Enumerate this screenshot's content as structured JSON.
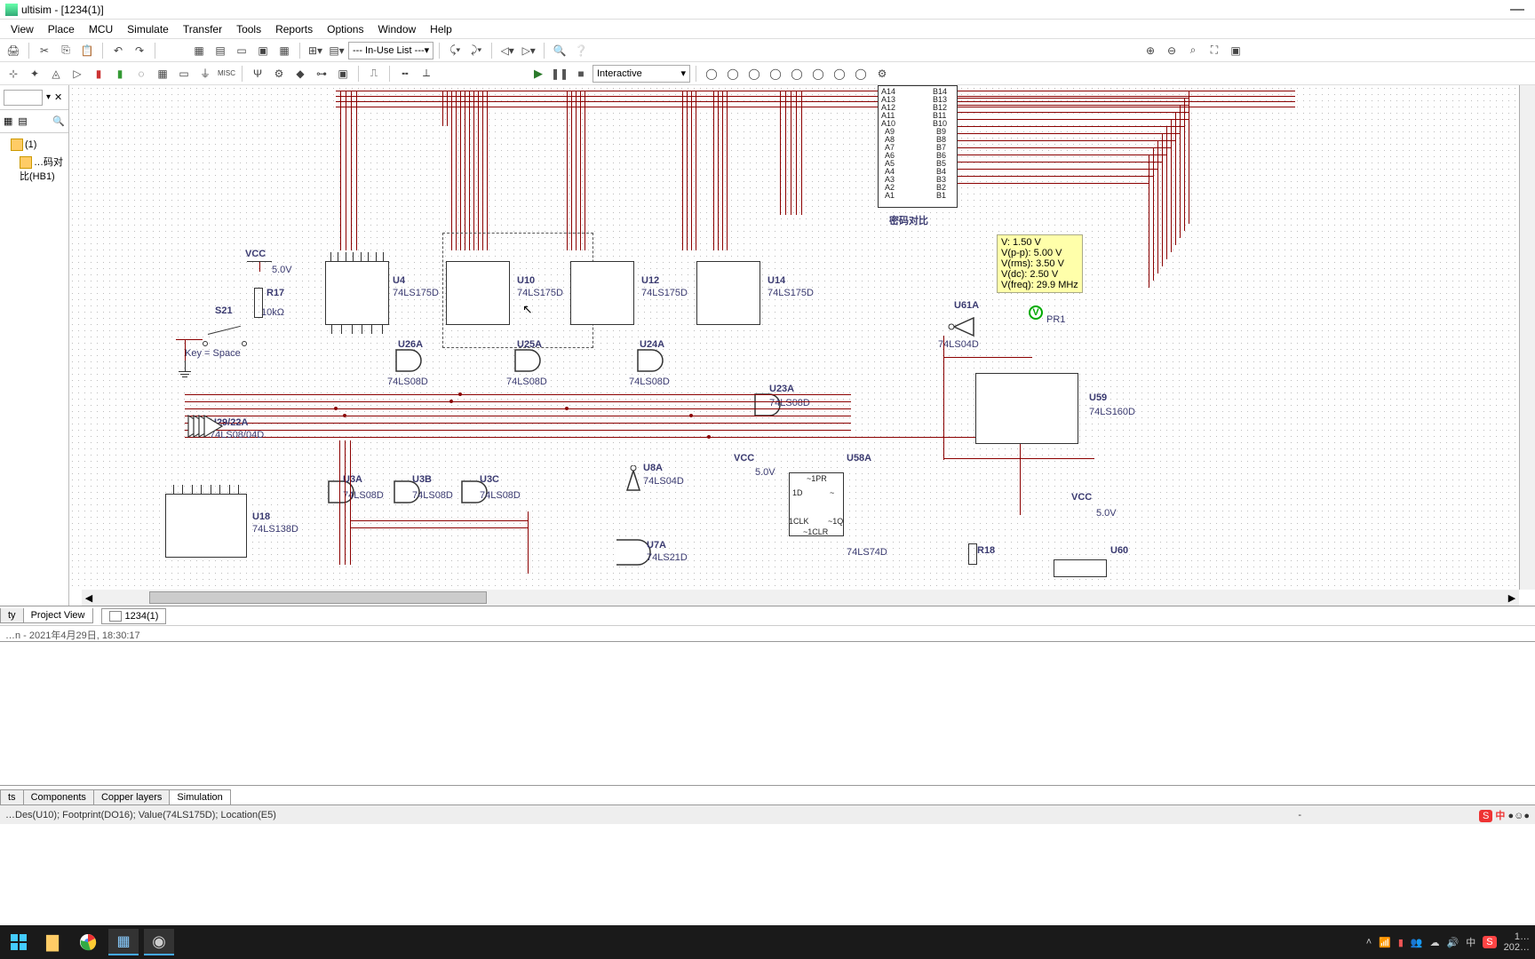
{
  "app": {
    "title": "ultisim - [1234(1)]"
  },
  "menu": {
    "items": [
      "View",
      "Place",
      "MCU",
      "Simulate",
      "Transfer",
      "Tools",
      "Reports",
      "Options",
      "Window",
      "Help"
    ]
  },
  "toolbar": {
    "inuse_combo": "--- In-Use List ---",
    "mode": "Interactive"
  },
  "tree": {
    "root": "(1)",
    "child": "…码对比(HB1)"
  },
  "sidebar_tabs": {
    "a": "ty",
    "b": "Project View"
  },
  "sheet": {
    "name": "1234(1)"
  },
  "statusline": "…n   -   2021年4月29日, 18:30:17",
  "ss_tabs": {
    "a": "ts",
    "b": "Components",
    "c": "Copper layers",
    "d": "Simulation"
  },
  "statusbar": "…Des(U10); Footprint(DO16); Value(74LS175D); Location(E5)",
  "components": {
    "vcc1": {
      "label": "VCC",
      "value": "5.0V"
    },
    "r17": {
      "name": "R17",
      "value": "10kΩ"
    },
    "s21": {
      "name": "S21",
      "key": "Key = Space"
    },
    "u4": {
      "name": "U4",
      "val": "74LS175D"
    },
    "u10": {
      "name": "U10",
      "val": "74LS175D"
    },
    "u12": {
      "name": "U12",
      "val": "74LS175D"
    },
    "u14": {
      "name": "U14",
      "val": "74LS175D"
    },
    "u26a": {
      "name": "U26A",
      "val": "74LS08D"
    },
    "u25a": {
      "name": "U25A",
      "val": "74LS08D"
    },
    "u24a": {
      "name": "U24A",
      "val": "74LS08D"
    },
    "u23a": {
      "name": "U23A",
      "val": "74LS08D"
    },
    "u3a": {
      "name": "U3A",
      "val": "74LS08D"
    },
    "u3b": {
      "name": "U3B",
      "val": "74LS08D"
    },
    "u3c": {
      "name": "U3C",
      "val": "74LS08D"
    },
    "u8a": {
      "name": "U8A",
      "val": "74LS04D"
    },
    "u7a": {
      "name": "U7A",
      "val": "74LS21D"
    },
    "u18": {
      "name": "U18",
      "val": "74LS138D"
    },
    "u58a": {
      "name": "U58A",
      "val": "74LS74D"
    },
    "u59": {
      "name": "U59",
      "val": "74LS160D"
    },
    "u60": {
      "name": "U60"
    },
    "u61a": {
      "name": "U61A",
      "val": "74LS04D"
    },
    "r18": {
      "name": "R18"
    },
    "vcc2": {
      "label": "VCC",
      "value": "5.0V"
    },
    "vcc3": {
      "label": "VCC",
      "value": "5.0V"
    },
    "uarr": {
      "name": "U29/22A",
      "val": "74LS08/04D"
    },
    "pwcompare": "密码对比",
    "pr1": "PR1"
  },
  "comparator_pins": {
    "left": [
      "A14",
      "A13",
      "A12",
      "A11",
      "A10",
      "A9",
      "A8",
      "A7",
      "A6",
      "A5",
      "A4",
      "A3",
      "A2",
      "A1"
    ],
    "right": [
      "B14",
      "B13",
      "B12",
      "B11",
      "B10",
      "B9",
      "B8",
      "B7",
      "B6",
      "B5",
      "B4",
      "B3",
      "B2",
      "B1"
    ]
  },
  "probe": {
    "l1": "V: 1.50 V",
    "l2": "V(p-p): 5.00 V",
    "l3": "V(rms): 3.50 V",
    "l4": "V(dc): 2.50 V",
    "l5": "V(freq): 29.9 MHz"
  },
  "taskbar": {
    "time": "1…",
    "year": "202…",
    "ime": "中"
  }
}
